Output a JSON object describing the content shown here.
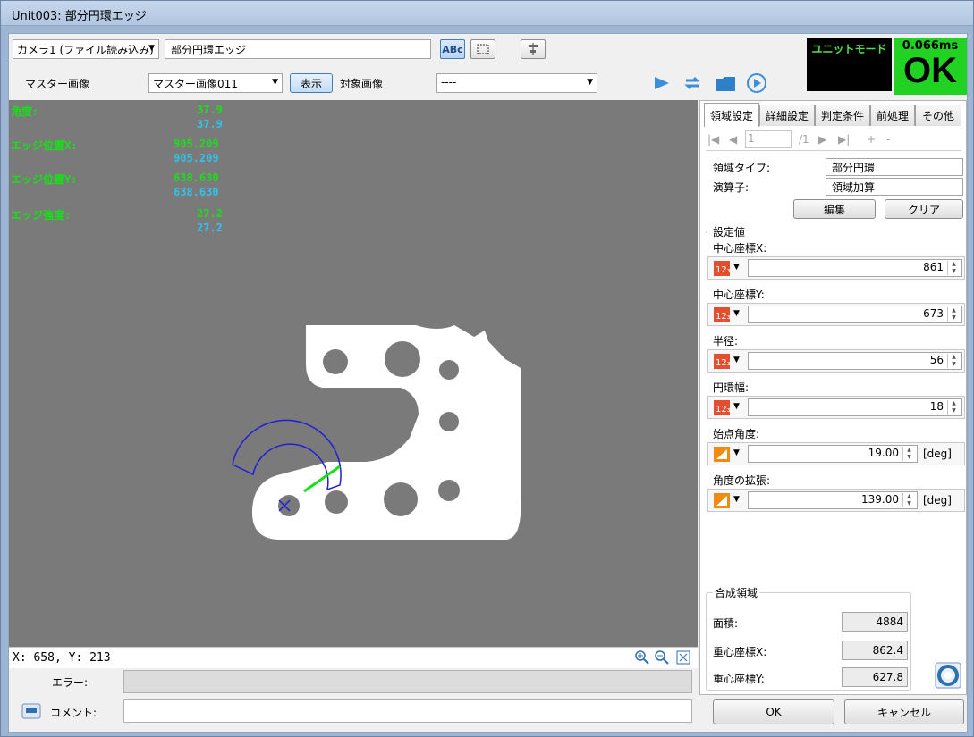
{
  "window": {
    "title": "Unit003: 部分円環エッジ"
  },
  "toolbar": {
    "camera_select": "カメラ1 (ファイル読み込み)",
    "unit_name": "部分円環エッジ",
    "master_label": "マスター画像",
    "master_select": "マスター画像011",
    "show_button": "表示",
    "target_label": "対象画像",
    "target_select": "----",
    "abc_btn": "ABc"
  },
  "status": {
    "unit_mode": "ユニットモード",
    "time": "0.066ms",
    "result": "OK"
  },
  "overlay": {
    "angle_label": "角度:",
    "angle_1": "37.9",
    "angle_2": "37.9",
    "edgex_label": "エッジ位置X:",
    "edgex_1": "905.209",
    "edgex_2": "905.209",
    "edgey_label": "エッジ位置Y:",
    "edgey_1": "638.630",
    "edgey_2": "638.630",
    "strength_label": "エッジ強度:",
    "strength_1": "27.2",
    "strength_2": "27.2"
  },
  "coord": {
    "readout": "X: 658, Y: 213"
  },
  "tabs": [
    "領域設定",
    "詳細設定",
    "判定条件",
    "前処理",
    "その他"
  ],
  "nav": {
    "page": "1",
    "total": "/1",
    "plus": "+",
    "minus": "-"
  },
  "region": {
    "type_label": "領域タイプ:",
    "type_value": "部分円環",
    "op_label": "演算子:",
    "op_value": "領域加算",
    "edit_button": "編集",
    "clear_button": "クリア"
  },
  "settings": {
    "group_label": "設定値",
    "cx_label": "中心座標X:",
    "cx": "861",
    "cy_label": "中心座標Y:",
    "cy": "673",
    "radius_label": "半径:",
    "radius": "56",
    "width_label": "円環幅:",
    "width": "18",
    "start_label": "始点角度:",
    "start": "19.00",
    "start_unit": "[deg]",
    "extend_label": "角度の拡張:",
    "extend": "139.00",
    "extend_unit": "[deg]"
  },
  "composite": {
    "group_label": "合成領域",
    "area_label": "面積:",
    "area": "4884",
    "gx_label": "重心座標X:",
    "gx": "862.4",
    "gy_label": "重心座標Y:",
    "gy": "627.8"
  },
  "bottom": {
    "error_label": "エラー:",
    "comment_label": "コメント:",
    "ok_button": "OK",
    "cancel_button": "キャンセル"
  },
  "colors": {
    "result_bg": "#22d222",
    "overlay_green": "#18e018",
    "overlay_cyan": "#2ec4ea"
  }
}
